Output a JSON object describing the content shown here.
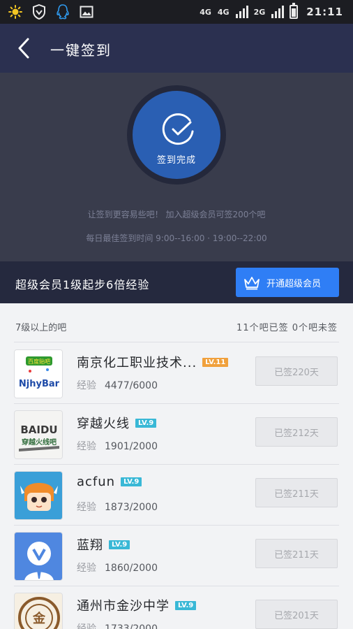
{
  "status_bar": {
    "icons": [
      "brightness-icon",
      "shield-icon",
      "qq-penguin-icon",
      "image-icon"
    ],
    "network1": "4G",
    "network2": "4G",
    "network3": "2G",
    "time": "21:11"
  },
  "header": {
    "title": "一键签到",
    "back_icon": "chevron-left-icon"
  },
  "hero": {
    "status_label": "签到完成",
    "promo": "让签到更容易些吧！ 加入超级会员可签200个吧",
    "best_time": "每日最佳签到时间  9:00--16:00  ·  19:00--22:00"
  },
  "vip": {
    "text": "超级会员1级起步6倍经验",
    "button_label": "开通超级会员",
    "button_icon": "crown-icon"
  },
  "list": {
    "header_left": "7级以上的吧",
    "header_right": "11个吧已签  0个吧未签",
    "exp_label": "经验",
    "items": [
      {
        "name": "南京化工职业技术...",
        "level": "LV.11",
        "level_color": "#f0a03c",
        "exp": "4477/6000",
        "signed": "已签220天"
      },
      {
        "name": "穿越火线",
        "level": "LV.9",
        "level_color": "#39b8d6",
        "exp": "1901/2000",
        "signed": "已签212天"
      },
      {
        "name": "acfun",
        "level": "LV.9",
        "level_color": "#39b8d6",
        "exp": "1873/2000",
        "signed": "已签211天"
      },
      {
        "name": "蓝翔",
        "level": "LV.9",
        "level_color": "#39b8d6",
        "exp": "1860/2000",
        "signed": "已签211天"
      },
      {
        "name": "通州市金沙中学",
        "level": "LV.9",
        "level_color": "#39b8d6",
        "exp": "1733/2000",
        "signed": "已签201天"
      }
    ]
  },
  "avatar_text": {
    "njhy_badge": "百度贴吧",
    "njhy_word": "NjhyBar",
    "cf_top": "BAIDU",
    "cf_bottom": "穿越火线吧",
    "school_mark": "金"
  },
  "colors": {
    "header_bg": "#2b3050",
    "hero_bg": "#393c4c",
    "circle": "#2a5fb3",
    "vip_button": "#2f7ef5"
  }
}
